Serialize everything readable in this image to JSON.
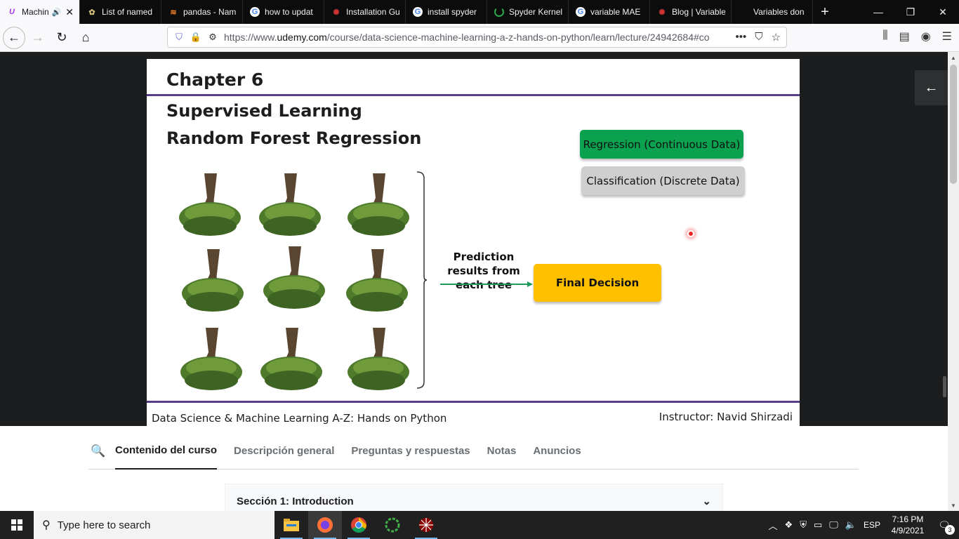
{
  "browser": {
    "tabs": [
      {
        "label": "Machin",
        "icon": "udemy-icon",
        "active": true
      },
      {
        "label": "List of named",
        "icon": "python-icon"
      },
      {
        "label": "pandas - Nam",
        "icon": "stackoverflow-icon"
      },
      {
        "label": "how to updat",
        "icon": "google-icon"
      },
      {
        "label": "Installation Gu",
        "icon": "spyder-icon"
      },
      {
        "label": "install spyder",
        "icon": "google-icon"
      },
      {
        "label": "Spyder Kernel",
        "icon": "loading-icon"
      },
      {
        "label": "variable MAE",
        "icon": "google-icon"
      },
      {
        "label": "Blog | Variable",
        "icon": "spyder-icon"
      },
      {
        "label": "Variables don",
        "icon": "blank-icon"
      }
    ],
    "url_prefix": "https://www.",
    "url_domain": "udemy.com",
    "url_rest": "/course/data-science-machine-learning-a-z-hands-on-python/learn/lecture/24942684#co"
  },
  "slide": {
    "chapter": "Chapter 6",
    "heading1": "Supervised Learning",
    "heading2": "Random Forest Regression",
    "regression_label": "Regression (Continuous Data)",
    "classification_label": "Classification (Discrete Data)",
    "prediction_text": "Prediction results from each tree",
    "final_decision": "Final Decision",
    "course_footer": "Data Science & Machine Learning A-Z: Hands on Python",
    "instructor_footer": "Instructor: Navid Shirzadi",
    "colors": {
      "regression": "#0aa14f",
      "classification": "#cfcfcf",
      "final": "#ffc000",
      "rule": "#5a3d8a"
    }
  },
  "course_tabs": [
    {
      "label": "Contenido del curso",
      "active": true
    },
    {
      "label": "Descripción general"
    },
    {
      "label": "Preguntas y respuestas"
    },
    {
      "label": "Notas"
    },
    {
      "label": "Anuncios"
    }
  ],
  "section": {
    "title": "Sección 1: Introduction"
  },
  "taskbar": {
    "search_placeholder": "Type here to search",
    "language": "ESP",
    "time": "7:16 PM",
    "date": "4/9/2021",
    "notifications": "3"
  }
}
